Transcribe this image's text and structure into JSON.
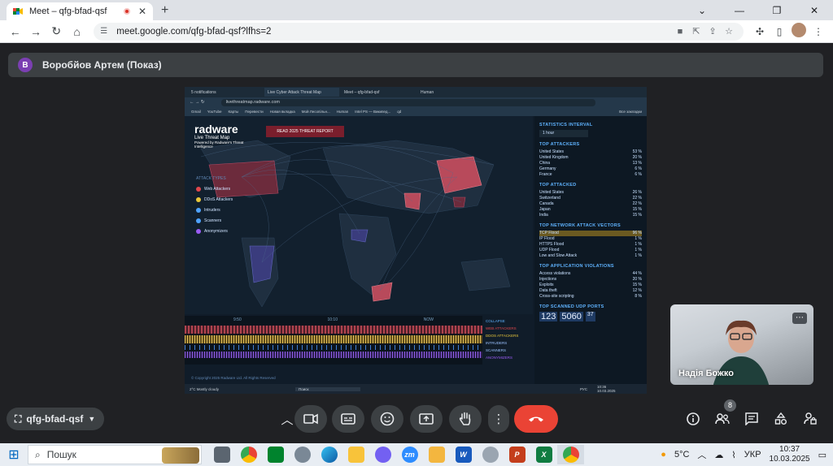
{
  "browser": {
    "tab_title": "Meet – qfg-bfad-qsf",
    "url": "meet.google.com/qfg-bfad-qsf?lfhs=2"
  },
  "meet": {
    "presenter_initial": "В",
    "presenter_label": "Воробйов Артем (Показ)",
    "self_name": "Надія Божко",
    "meeting_code": "qfg-bfad-qsf",
    "participants_count": "8"
  },
  "shared_screen": {
    "tabs": [
      "5 notifications",
      "Live Cyber Attack Threat Map",
      "Meet – qfg-bfad-qsf",
      "Human"
    ],
    "url": "livethreatmap.radware.com",
    "bookmarks": [
      "Gmail",
      "YouTube",
      "Карты",
      "Перевести",
      "Новая вкладка",
      "Мой Лесопільн...",
      "Human",
      "Intel PS — Википед...",
      "qd",
      "Все закладки"
    ],
    "brand": "radware",
    "brand_sub": "Live Threat Map",
    "brand_tag": "Powered by Radware's Threat Intelligence",
    "report_button": "READ 2025 THREAT REPORT",
    "attack_types_title": "ATTACK TYPES",
    "attack_types": [
      {
        "label": "Web Attackers",
        "color": "#e0474c"
      },
      {
        "label": "DDoS Attackers",
        "color": "#e9c73a"
      },
      {
        "label": "Intruders",
        "color": "#4fa3ff"
      },
      {
        "label": "Scanners",
        "color": "#4fa3ff"
      },
      {
        "label": "Anonymizers",
        "color": "#9a5cf5"
      }
    ],
    "timeline_labels": [
      "9:50",
      "10:10",
      "NOW"
    ],
    "collapse_label": "COLLAPSE",
    "legend": [
      "WEB ATTACKERS",
      "DDOS ATTACKERS",
      "INTRUDERS",
      "SCANNERS",
      "ANONYMIZERS"
    ],
    "footer_left": "© Copyright 2025 Radware Ltd. All Rights Reserved",
    "statistics_interval_title": "STATISTICS INTERVAL",
    "interval_value": "1 hour",
    "top_attackers_title": "TOP ATTACKERS",
    "top_attackers": [
      {
        "name": "United States",
        "pct": "53 %"
      },
      {
        "name": "United Kingdom",
        "pct": "20 %"
      },
      {
        "name": "China",
        "pct": "13 %"
      },
      {
        "name": "Germany",
        "pct": "6 %"
      },
      {
        "name": "France",
        "pct": "6 %"
      }
    ],
    "top_attacked_title": "TOP ATTACKED",
    "top_attacked": [
      {
        "name": "United States",
        "pct": "26 %"
      },
      {
        "name": "Switzerland",
        "pct": "22 %"
      },
      {
        "name": "Canada",
        "pct": "22 %"
      },
      {
        "name": "Japan",
        "pct": "15 %"
      },
      {
        "name": "India",
        "pct": "15 %"
      }
    ],
    "vectors_title": "TOP NETWORK ATTACK VECTORS",
    "vectors": [
      {
        "name": "TCP Flood",
        "pct": "96 %"
      },
      {
        "name": "IP Flood",
        "pct": "1 %"
      },
      {
        "name": "HTTPS Flood",
        "pct": "1 %"
      },
      {
        "name": "UDP Flood",
        "pct": "1 %"
      },
      {
        "name": "Low and Slow Attack",
        "pct": "1 %"
      }
    ],
    "app_violations_title": "TOP APPLICATION VIOLATIONS",
    "app_violations": [
      {
        "name": "Access violations",
        "pct": "44 %"
      },
      {
        "name": "Injections",
        "pct": "20 %"
      },
      {
        "name": "Exploits",
        "pct": "15 %"
      },
      {
        "name": "Data theft",
        "pct": "12 %"
      },
      {
        "name": "Cross-site scripting",
        "pct": "8 %"
      }
    ],
    "udp_title": "TOP SCANNED UDP PORTS",
    "udp_ports": [
      "123",
      "5060",
      "37"
    ],
    "weather": "2°C Mostly cloudy",
    "inner_search": "Поиск",
    "inner_lang": "РУС",
    "inner_time": "10:36",
    "inner_date": "10.03.2025"
  },
  "taskbar": {
    "search_placeholder": "Пошук",
    "temperature": "5°C",
    "lang": "УКР",
    "time": "10:37",
    "date": "10.03.2025"
  }
}
